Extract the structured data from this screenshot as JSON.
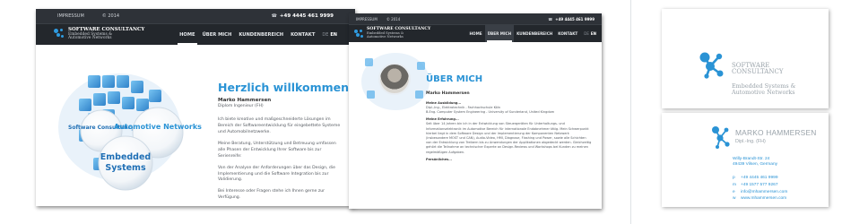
{
  "colors": {
    "accent": "#2a93d5",
    "dark_header": "#2e3238",
    "nav_bar": "#23272c",
    "card_gray": "#9aa3aa"
  },
  "site": {
    "impressum": "IMPRESSUM",
    "copyright": "© 2014",
    "phone": "+49 4445 461 9999",
    "logo_title": "SOFTWARE CONSULTANCY",
    "logo_sub_1": "Embedded Systems &",
    "logo_sub_2": "Automotive Networks",
    "nav": [
      "HOME",
      "ÜBER MICH",
      "KUNDENBEREICH",
      "KONTAKT"
    ],
    "lang_de": "DE",
    "lang_en": "EN"
  },
  "home": {
    "title": "Herzlich willkommen",
    "name": "Marko Hammersen",
    "role": "Diplom Ingenieur (FH)",
    "p1": "Ich biete kreative und maßgeschneiderte Lösungen im Bereich der Softwareentwicklung für eingebettete Systeme und Automobilnetzwerke.",
    "p2": "Meine Beratung, Unterstützung und Betreuung umfassen alle Phasen der Entwicklung Ihrer Software bis zur Serienreife:",
    "p3": "Von der Analyse der Anforderungen über das Design, die Implementierung und die Software Integration bis zur Validierung.",
    "p4": "Bei Interesse oder Fragen stehe ich Ihnen gerne zur Verfügung.",
    "bubble_software": "Software Consultancy",
    "bubble_automotive": "Automotive Networks",
    "bubble_embedded_1": "Embedded",
    "bubble_embedded_2": "Systems"
  },
  "about": {
    "title": "ÜBER MICH",
    "name": "Marko Hammersen",
    "h_education": "Meine Ausbildung...",
    "edu_1": "Dipl.-Ing., Elektrotechnik - Fachhochschule Köln",
    "edu_2": "B.Eng. Computer System Engineering - University of Sunderland, United Kingdom",
    "h_experience": "Meine Erfahrung...",
    "exp": "Seit über 14 Jahren bin ich in der Entwicklung von Steuergeräten für Unterhaltungs- und Informationselektronik im Automotive Bereich für internationale Endabnehmer tätig. Mein Schwerpunkt hierbei liegt in dem Software Design und der Implementierung der Komponenten Netzwerk (insbesondere MOST und CAN), Audio-Video, HMI, Diagnose, Flashing und Power, sowie alle Schichten von der Entwicklung von Treibern bis zu Anwendungen der Applikationen abgedeckt werden. Gleichzeitig gehört die Teilnahme an technischer Experte an Design-Reviews und Workshops bei Kunden zu meinen regelmäßigen Aufgaben.",
    "h_personal": "Persönliches..."
  },
  "card_front": {
    "title_1": "SOFTWARE",
    "title_2": "CONSULTANCY",
    "sub_1": "Embedded Systems &",
    "sub_2": "Automotive Networks"
  },
  "card_back": {
    "name": "MARKO HAMMERSEN",
    "role": "Dipl.-Ing. (FH)",
    "street": "Willy-Brandt-Str. 24",
    "city": "49439 Vilsen, Germany",
    "phone_label": "p",
    "phone": "+49 4445 461 9999",
    "mobile_label": "m",
    "mobile": "+49 1577 577 9267",
    "email_label": "e",
    "email": "info@mhammersen.com",
    "web_label": "w",
    "web": "www.mhammersen.com"
  }
}
